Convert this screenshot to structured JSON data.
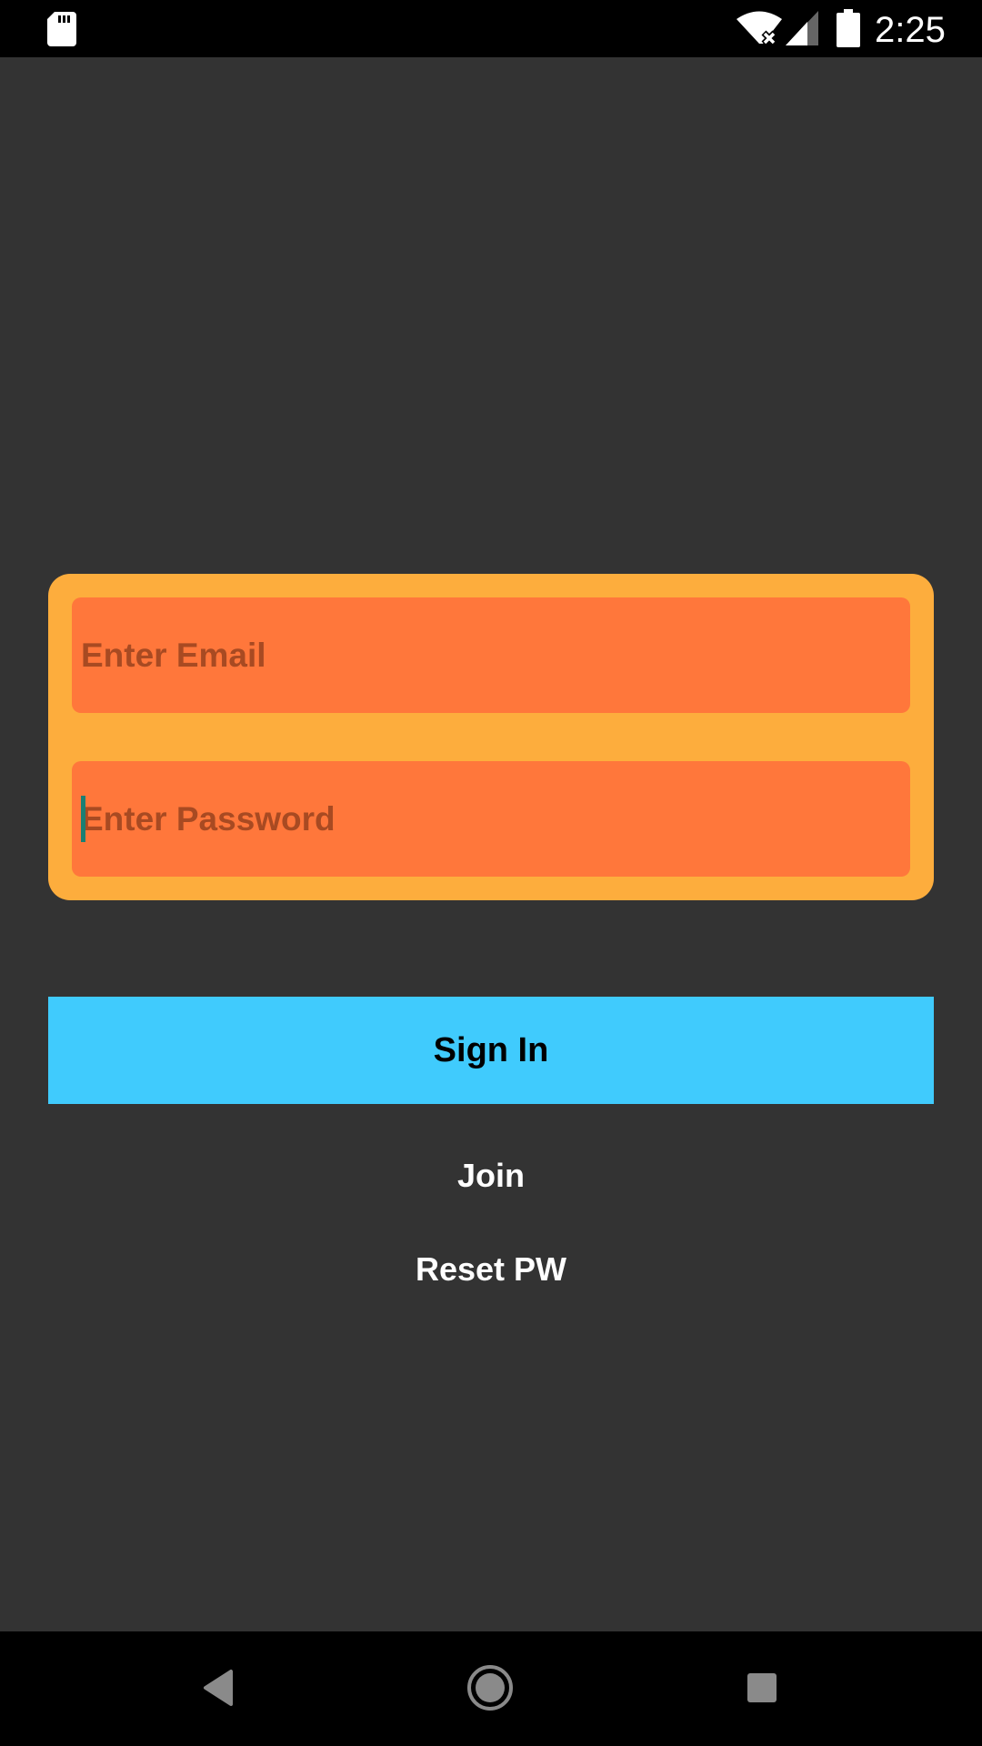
{
  "status_bar": {
    "time": "2:25",
    "icons": [
      "sd-card-icon",
      "wifi-off-icon",
      "signal-icon",
      "battery-icon"
    ]
  },
  "login_form": {
    "email": {
      "value": "",
      "placeholder": "Enter Email"
    },
    "password": {
      "value": "",
      "placeholder": "Enter Password"
    }
  },
  "actions": {
    "sign_in_label": "Sign In",
    "join_label": "Join",
    "reset_label": "Reset PW"
  },
  "nav_bar": {
    "icons": [
      "back-icon",
      "home-icon",
      "recents-icon"
    ]
  },
  "colors": {
    "background": "#333333",
    "card": "#fdad3d",
    "field": "#ff773b",
    "field_text": "#a84a22",
    "primary_button": "#40cbfd",
    "cursor": "#1b7f73"
  }
}
